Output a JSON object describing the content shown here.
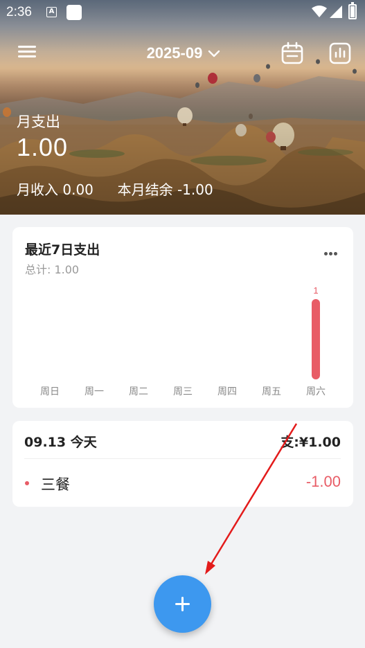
{
  "status_bar": {
    "time": "2:36",
    "a_badge": "A"
  },
  "toolbar": {
    "month": "2025-09"
  },
  "summary": {
    "label": "月支出",
    "amount": "1.00",
    "income_label": "月收入",
    "income_value": "0.00",
    "balance_label": "本月结余",
    "balance_value": "-1.00"
  },
  "recent_card": {
    "title": "最近7日支出",
    "subtitle": "总计: 1.00"
  },
  "chart_data": {
    "type": "bar",
    "categories": [
      "周日",
      "周一",
      "周二",
      "周三",
      "周四",
      "周五",
      "周六"
    ],
    "values": [
      0,
      0,
      0,
      0,
      0,
      0,
      1
    ],
    "data_labels": [
      "",
      "",
      "",
      "",
      "",
      "",
      "1"
    ],
    "title": "最近7日支出",
    "subtitle": "总计: 1.00",
    "ylim": [
      0,
      1
    ],
    "grid": false,
    "bar_color": "#e85c66"
  },
  "day_card": {
    "date": "09.13 今天",
    "total": "支:¥1.00",
    "entries": [
      {
        "category": "三餐",
        "amount": "-1.00"
      }
    ]
  },
  "colors": {
    "expense": "#e85c66",
    "accent": "#3d98ef",
    "annotation_arrow": "#e31b1b"
  }
}
